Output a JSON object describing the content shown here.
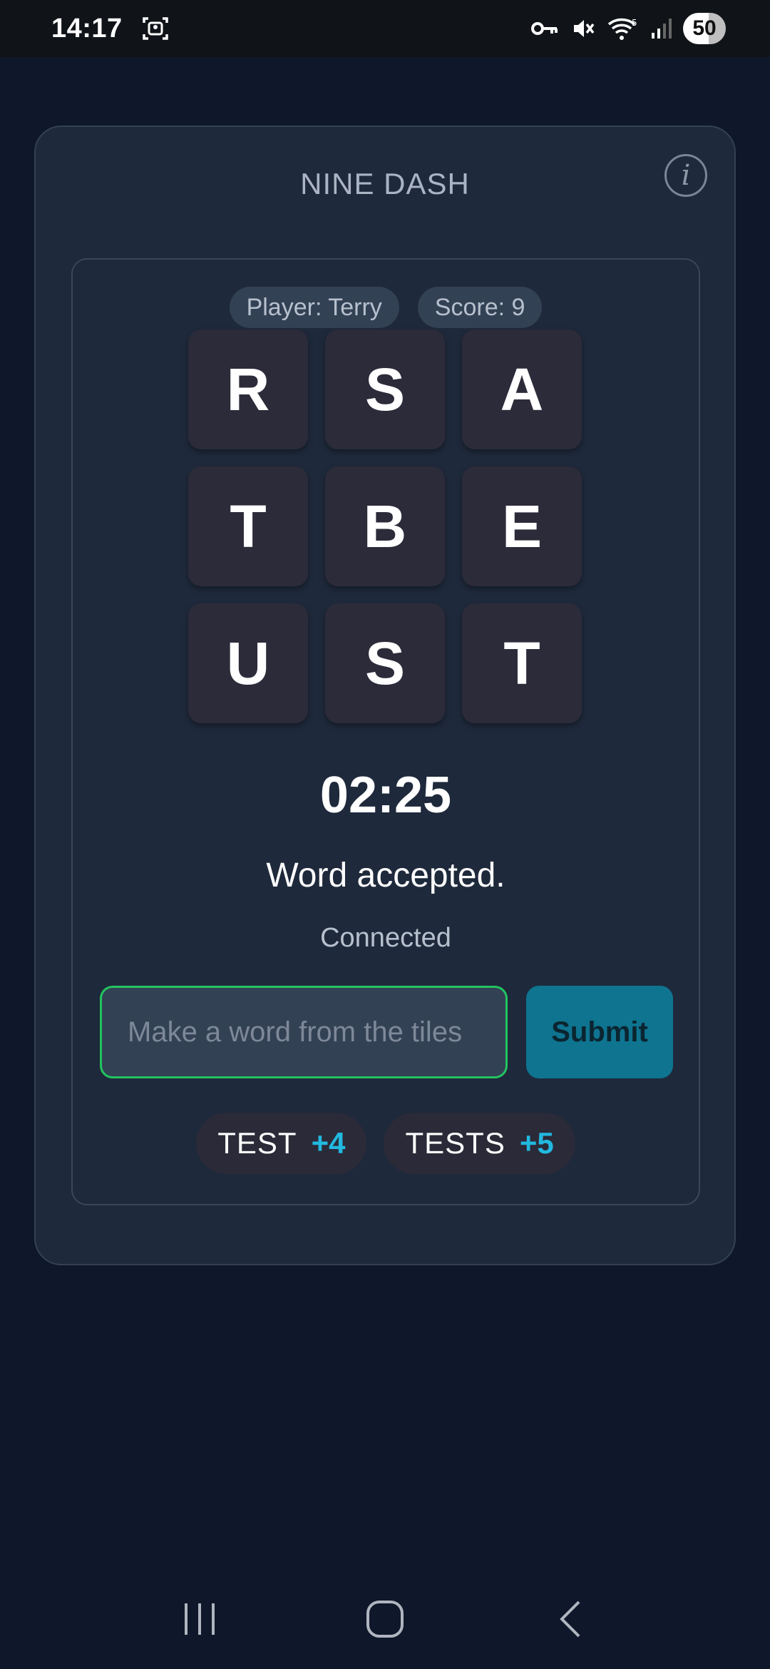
{
  "status": {
    "time": "14:17",
    "battery": "50"
  },
  "app": {
    "title": "NINE DASH",
    "info_glyph": "i"
  },
  "player": {
    "label": "Player: Terry",
    "score": "Score: 9"
  },
  "tiles": [
    "R",
    "S",
    "A",
    "T",
    "B",
    "E",
    "U",
    "S",
    "T"
  ],
  "timer": "02:25",
  "message": "Word accepted.",
  "connection": "Connected",
  "input": {
    "value": "",
    "placeholder": "Make a word from the tiles"
  },
  "submit_label": "Submit",
  "found_words": [
    {
      "word": "TEST",
      "points": "+4"
    },
    {
      "word": "TESTS",
      "points": "+5"
    }
  ],
  "colors": {
    "accent": "#22b8e0",
    "input_border": "#22c55e",
    "submit_bg": "#0e7490"
  }
}
